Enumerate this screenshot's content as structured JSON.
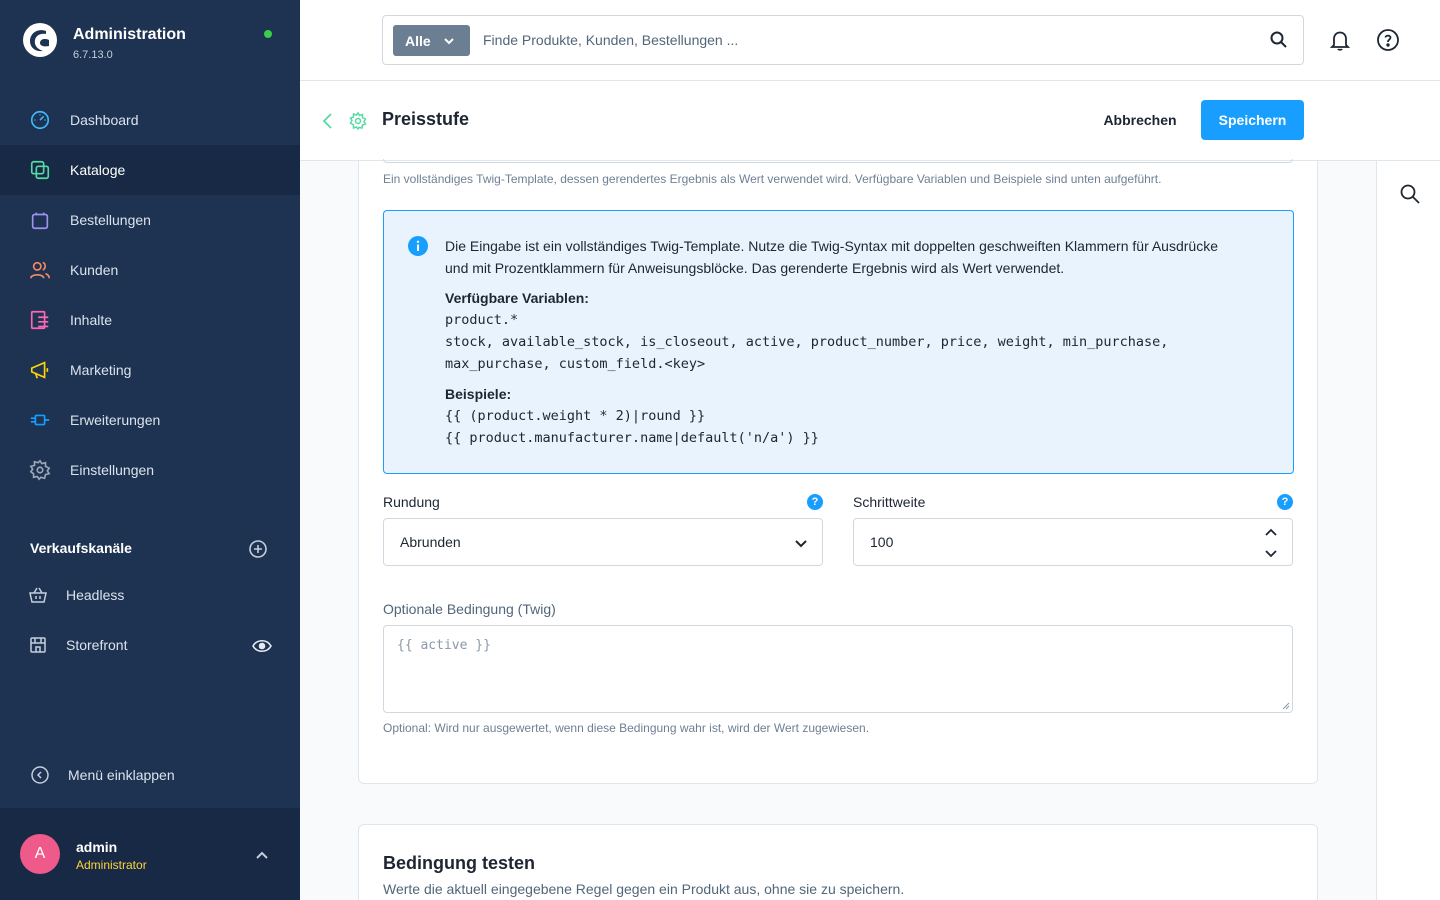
{
  "brand": {
    "title": "Administration",
    "version": "6.7.13.0"
  },
  "nav": {
    "items": [
      {
        "label": "Dashboard",
        "icon": "dashboard-icon",
        "color": "#40b8f7"
      },
      {
        "label": "Kataloge",
        "icon": "catalog-icon",
        "color": "#57d9a3",
        "active": true
      },
      {
        "label": "Bestellungen",
        "icon": "orders-icon",
        "color": "#a092f0"
      },
      {
        "label": "Kunden",
        "icon": "customers-icon",
        "color": "#f88962"
      },
      {
        "label": "Inhalte",
        "icon": "content-icon",
        "color": "#ff68b4"
      },
      {
        "label": "Marketing",
        "icon": "marketing-icon",
        "color": "#ffd700"
      },
      {
        "label": "Erweiterungen",
        "icon": "extensions-icon",
        "color": "#189eff"
      },
      {
        "label": "Einstellungen",
        "icon": "settings-icon",
        "color": "#9aa8b5"
      }
    ]
  },
  "sales_channels": {
    "title": "Verkaufskanäle",
    "items": [
      {
        "label": "Headless",
        "icon": "basket-icon"
      },
      {
        "label": "Storefront",
        "icon": "storefront-icon"
      }
    ]
  },
  "collapse_label": "Menü einklappen",
  "user": {
    "initial": "A",
    "name": "admin",
    "role": "Administrator"
  },
  "search": {
    "type_label": "Alle",
    "placeholder": "Finde Produkte, Kunden, Bestellungen ..."
  },
  "smartbar": {
    "title": "Preisstufe",
    "cancel_label": "Abbrechen",
    "save_label": "Speichern"
  },
  "form": {
    "template_help": "Ein vollständiges Twig-Template, dessen gerendertes Ergebnis als Wert verwendet wird. Verfügbare Variablen und Beispiele sind unten aufgeführt.",
    "info": {
      "text": "Die Eingabe ist ein vollständiges Twig-Template. Nutze die Twig-Syntax mit doppelten geschweiften Klammern für Ausdrücke und mit Prozentklammern für Anweisungsblöcke. Das gerenderte Ergebnis wird als Wert verwendet.",
      "variables_label": "Verfügbare Variablen:",
      "variables_line1": "product.*",
      "variables_line2": "stock, available_stock, is_closeout, active, product_number, price, weight, min_purchase,",
      "variables_line3": "max_purchase, custom_field.<key>",
      "examples_label": "Beispiele:",
      "example1": "{{ (product.weight * 2)|round }}",
      "example2": "{{ product.manufacturer.name|default('n/a') }}"
    },
    "rounding": {
      "label": "Rundung",
      "value": "Abrunden"
    },
    "step": {
      "label": "Schrittweite",
      "value": "100"
    },
    "condition": {
      "label": "Optionale Bedingung (Twig)",
      "placeholder": "{{ active }}",
      "help": "Optional: Wird nur ausgewertet, wenn diese Bedingung wahr ist, wird der Wert zugewiesen."
    }
  },
  "test_card": {
    "title": "Bedingung testen",
    "subtitle": "Werte die aktuell eingegebene Regel gegen ein Produkt aus, ohne sie zu speichern."
  }
}
